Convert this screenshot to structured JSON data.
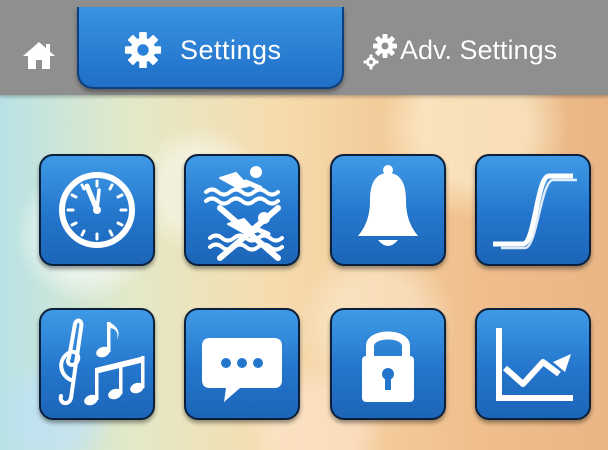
{
  "header": {
    "home": {
      "icon": "home-icon"
    },
    "tabs": [
      {
        "label": "Settings",
        "icon": "gear-icon",
        "active": true
      },
      {
        "label": "Adv. Settings",
        "icon": "gears-icon",
        "active": false
      }
    ]
  },
  "grid": {
    "tiles": [
      {
        "icon": "clock-icon"
      },
      {
        "icon": "swimming-allowed-forbidden-icon"
      },
      {
        "icon": "bell-icon"
      },
      {
        "icon": "s-curve-icon"
      },
      {
        "icon": "music-notes-icon"
      },
      {
        "icon": "chat-bubble-icon"
      },
      {
        "icon": "padlock-icon"
      },
      {
        "icon": "line-chart-icon"
      }
    ]
  },
  "colors": {
    "tile_blue": "#2476cc",
    "tile_border": "#0a1f3a",
    "topbar_gray": "#8e8f8e",
    "icon_white": "#ffffff"
  }
}
